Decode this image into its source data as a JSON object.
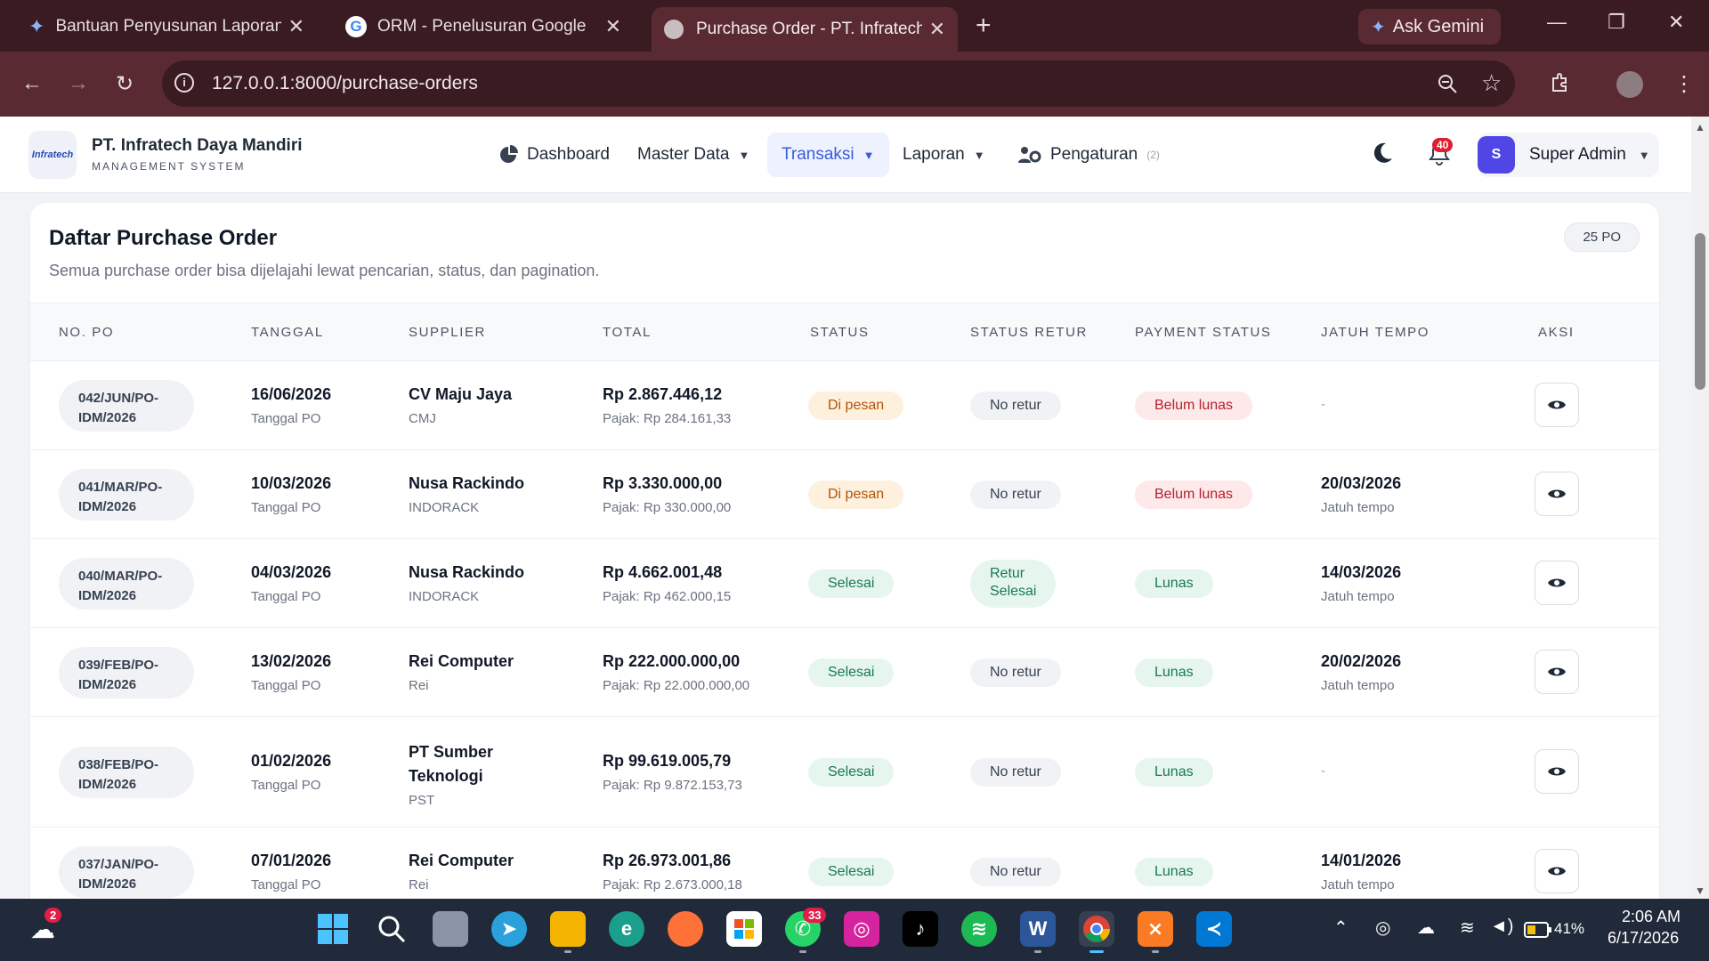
{
  "browser": {
    "tabs": [
      {
        "title": "Bantuan Penyusunan Laporan M",
        "icon": "gemini-icon"
      },
      {
        "title": "ORM - Penelusuran Google",
        "icon": "google-icon"
      },
      {
        "title": "Purchase Order - PT. Infratech D",
        "icon": "globe-icon"
      }
    ],
    "new_tab": "+",
    "ask_gemini": "Ask Gemini",
    "url": "127.0.0.1:8000/purchase-orders"
  },
  "app": {
    "company": "PT. Infratech Daya Mandiri",
    "subtitle": "MANAGEMENT SYSTEM",
    "logo_text": "Infratech",
    "nav": {
      "dashboard": "Dashboard",
      "master": "Master Data",
      "transaksi": "Transaksi",
      "laporan": "Laporan",
      "pengaturan": "Pengaturan",
      "pengaturan_count": "(2)"
    },
    "notif_count": "40",
    "user_initial": "S",
    "user_name": "Super Admin"
  },
  "card": {
    "title": "Daftar Purchase Order",
    "description": "Semua purchase order bisa dijelajahi lewat pencarian, status, dan pagination.",
    "count": "25 PO"
  },
  "table": {
    "headers": [
      "NO. PO",
      "TANGGAL",
      "SUPPLIER",
      "TOTAL",
      "STATUS",
      "STATUS RETUR",
      "PAYMENT STATUS",
      "JATUH TEMPO",
      "AKSI"
    ],
    "rows": [
      {
        "po1": "042/JUN/PO-",
        "po2": "IDM/2026",
        "date": "16/06/2026",
        "date_sub": "Tanggal PO",
        "supplier": "CV Maju Jaya",
        "supplier_code": "CMJ",
        "total": "Rp 2.867.446,12",
        "tax": "Pajak: Rp 284.161,33",
        "status": "Di pesan",
        "retur": "No retur",
        "payment": "Belum lunas",
        "due": "-",
        "due_sub": ""
      },
      {
        "po1": "041/MAR/PO-",
        "po2": "IDM/2026",
        "date": "10/03/2026",
        "date_sub": "Tanggal PO",
        "supplier": "Nusa Rackindo",
        "supplier_code": "INDORACK",
        "total": "Rp 3.330.000,00",
        "tax": "Pajak: Rp 330.000,00",
        "status": "Di pesan",
        "retur": "No retur",
        "payment": "Belum lunas",
        "due": "20/03/2026",
        "due_sub": "Jatuh tempo"
      },
      {
        "po1": "040/MAR/PO-",
        "po2": "IDM/2026",
        "date": "04/03/2026",
        "date_sub": "Tanggal PO",
        "supplier": "Nusa Rackindo",
        "supplier_code": "INDORACK",
        "total": "Rp 4.662.001,48",
        "tax": "Pajak: Rp 462.000,15",
        "status": "Selesai",
        "retur1": "Retur",
        "retur2": "Selesai",
        "payment": "Lunas",
        "due": "14/03/2026",
        "due_sub": "Jatuh tempo"
      },
      {
        "po1": "039/FEB/PO-",
        "po2": "IDM/2026",
        "date": "13/02/2026",
        "date_sub": "Tanggal PO",
        "supplier": "Rei Computer",
        "supplier_code": "Rei",
        "total": "Rp 222.000.000,00",
        "tax": "Pajak: Rp 22.000.000,00",
        "status": "Selesai",
        "retur": "No retur",
        "payment": "Lunas",
        "due": "20/02/2026",
        "due_sub": "Jatuh tempo"
      },
      {
        "po1": "038/FEB/PO-",
        "po2": "IDM/2026",
        "date": "01/02/2026",
        "date_sub": "Tanggal PO",
        "supplier1": "PT Sumber",
        "supplier2": "Teknologi",
        "supplier_code": "PST",
        "total": "Rp 99.619.005,79",
        "tax": "Pajak: Rp 9.872.153,73",
        "status": "Selesai",
        "retur": "No retur",
        "payment": "Lunas",
        "due": "-",
        "due_sub": ""
      },
      {
        "po1": "037/JAN/PO-",
        "po2": "IDM/2026",
        "date": "07/01/2026",
        "date_sub": "Tanggal PO",
        "supplier": "Rei Computer",
        "supplier_code": "Rei",
        "total": "Rp 26.973.001,86",
        "tax": "Pajak: Rp 2.673.000,18",
        "status": "Selesai",
        "retur": "No retur",
        "payment": "Lunas",
        "due": "14/01/2026",
        "due_sub": "Jatuh tempo"
      }
    ]
  },
  "taskbar": {
    "weather_badge": "2",
    "whatsapp_badge": "33",
    "battery": "41%",
    "time": "2:06 AM",
    "date": "6/17/2026"
  },
  "colors": {
    "chrome_dark": "#3a1b22",
    "chrome_mid": "#5a2a33",
    "accent": "#3b5bdb",
    "avatar": "#4f46e5"
  }
}
